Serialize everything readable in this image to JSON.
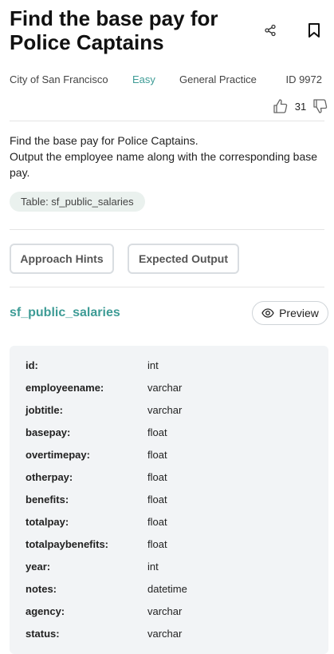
{
  "question": {
    "title": "Find the base pay for Police Captains",
    "company": "City of San Francisco",
    "difficulty": "Easy",
    "category": "General Practice",
    "id_label": "ID 9972"
  },
  "votes": {
    "count": "31"
  },
  "description": {
    "line1": "Find the base pay for Police Captains.",
    "line2": "Output the employee name along with the corresponding base pay."
  },
  "table_tag": "Table: sf_public_salaries",
  "buttons": {
    "hints": "Approach Hints",
    "output": "Expected Output",
    "preview": "Preview"
  },
  "schema": {
    "table_name": "sf_public_salaries",
    "columns": [
      {
        "name": "id:",
        "type": "int"
      },
      {
        "name": "employeename:",
        "type": "varchar"
      },
      {
        "name": "jobtitle:",
        "type": "varchar"
      },
      {
        "name": "basepay:",
        "type": "float"
      },
      {
        "name": "overtimepay:",
        "type": "float"
      },
      {
        "name": "otherpay:",
        "type": "float"
      },
      {
        "name": "benefits:",
        "type": "float"
      },
      {
        "name": "totalpay:",
        "type": "float"
      },
      {
        "name": "totalpaybenefits:",
        "type": "float"
      },
      {
        "name": "year:",
        "type": "int"
      },
      {
        "name": "notes:",
        "type": "datetime"
      },
      {
        "name": "agency:",
        "type": "varchar"
      },
      {
        "name": "status:",
        "type": "varchar"
      }
    ]
  },
  "icons": {
    "share": "share-icon",
    "bookmark": "bookmark-icon",
    "upvote": "thumbs-up-icon",
    "downvote": "thumbs-down-icon",
    "preview": "eye-icon"
  },
  "colors": {
    "accent": "#3e9c96",
    "tag_bg": "#eaf1ee",
    "schema_bg": "#f2f4f6"
  }
}
